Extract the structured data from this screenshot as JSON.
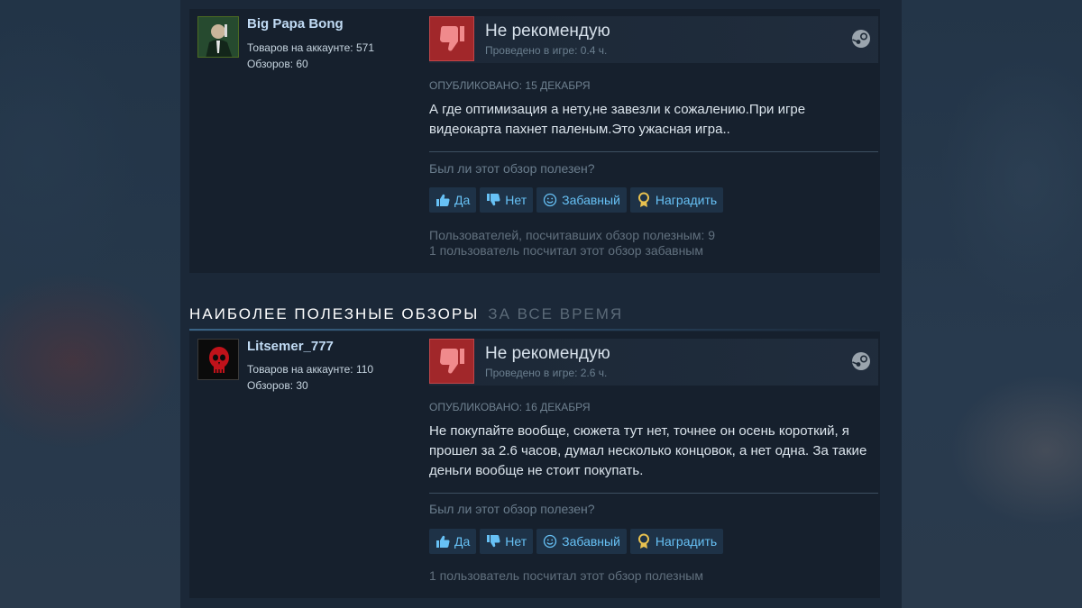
{
  "section": {
    "title": "НАИБОЛЕЕ ПОЛЕЗНЫЕ ОБЗОРЫ",
    "subtitle": "ЗА ВСЕ ВРЕМЯ"
  },
  "reviews": [
    {
      "author": "Big Papa Bong",
      "products": "Товаров на аккаунте: 571",
      "reviews_count": "Обзоров: 60",
      "verdict": "Не рекомендую",
      "hours": "Проведено в игре: 0.4 ч.",
      "posted": "ОПУБЛИКОВАНО: 15 ДЕКАБРЯ",
      "text": "А где оптимизация а нету,не завезли к сожалению.При игре видеокарта пахнет паленым.Это ужасная игра..",
      "helpful_question": "Был ли этот обзор полезен?",
      "buttons": {
        "yes": "Да",
        "no": "Нет",
        "funny": "Забавный",
        "award": "Наградить"
      },
      "stats": [
        "Пользователей, посчитавших обзор полезным: 9",
        "1 пользователь посчитал этот обзор забавным"
      ]
    },
    {
      "author": "Litsemer_777",
      "products": "Товаров на аккаунте: 110",
      "reviews_count": "Обзоров: 30",
      "verdict": "Не рекомендую",
      "hours": "Проведено в игре: 2.6 ч.",
      "posted": "ОПУБЛИКОВАНО: 16 ДЕКАБРЯ",
      "text": "Не покупайте вообще, сюжета тут нет, точнее он осень короткий, я прошел за 2.6 часов, думал несколько концовок, а нет одна. За такие деньги вообще не стоит покупать.",
      "helpful_question": "Был ли этот обзор полезен?",
      "buttons": {
        "yes": "Да",
        "no": "Нет",
        "funny": "Забавный",
        "award": "Наградить"
      },
      "stats": [
        "1 пользователь посчитал этот обзор полезным"
      ]
    }
  ]
}
